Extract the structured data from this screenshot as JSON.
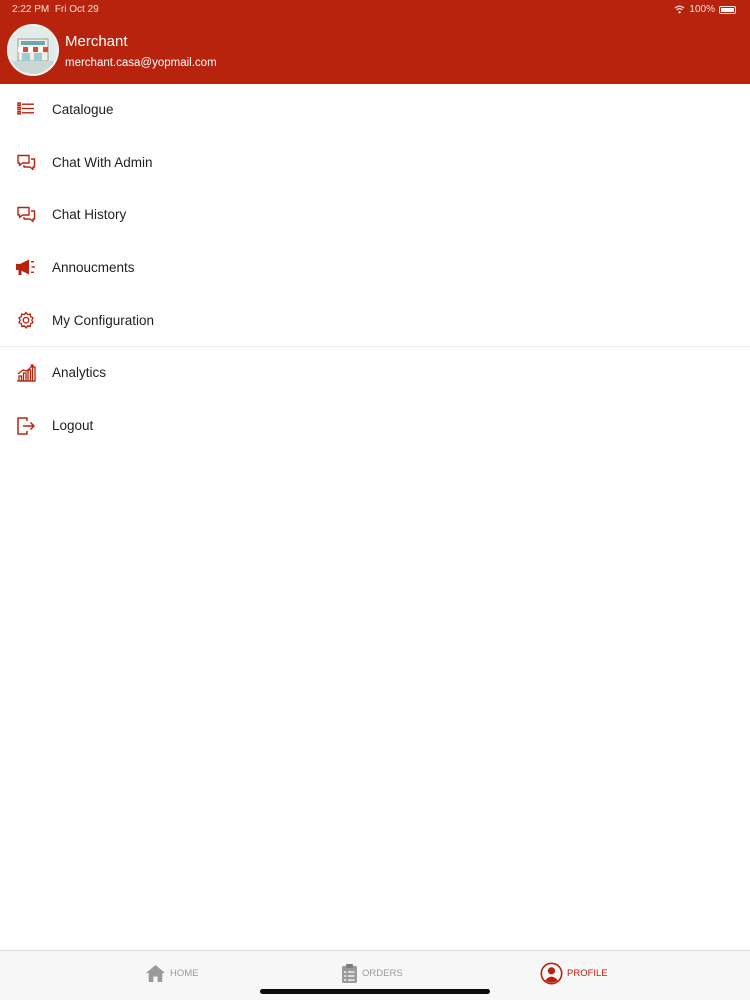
{
  "status_bar": {
    "time": "2:22 PM",
    "date": "Fri Oct 29",
    "battery": "100%"
  },
  "profile": {
    "name": "Merchant",
    "email": "merchant.casa@yopmail.com"
  },
  "menu": {
    "items": [
      {
        "label": "Catalogue",
        "icon": "list-icon"
      },
      {
        "label": "Chat With Admin",
        "icon": "chat-icon"
      },
      {
        "label": "Chat History",
        "icon": "chat-history-icon"
      },
      {
        "label": "Annoucments",
        "icon": "megaphone-icon"
      },
      {
        "label": "My Configuration",
        "icon": "gear-icon"
      },
      {
        "label": "Analytics",
        "icon": "analytics-icon"
      },
      {
        "label": "Logout",
        "icon": "logout-icon"
      }
    ]
  },
  "tabs": [
    {
      "label": "HOME",
      "icon": "home-icon",
      "active": false
    },
    {
      "label": "ORDERS",
      "icon": "clipboard-icon",
      "active": false
    },
    {
      "label": "PROFILE",
      "icon": "profile-icon",
      "active": true
    }
  ],
  "colors": {
    "brand": "#b8230e",
    "background": "#ffffff",
    "tabbar": "#f7f7f7",
    "inactive": "#9a9a9a"
  }
}
